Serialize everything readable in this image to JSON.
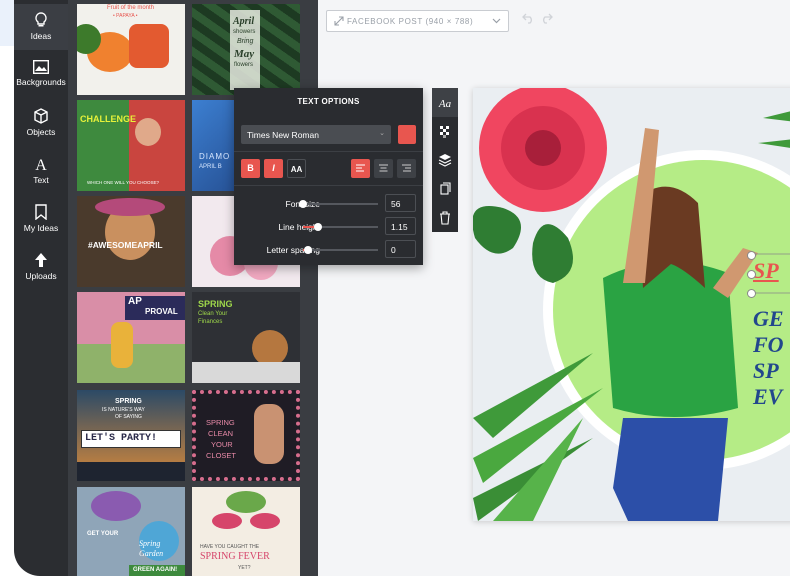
{
  "sidebar": {
    "items": [
      {
        "label": "Ideas",
        "icon": "lightbulb-icon"
      },
      {
        "label": "Backgrounds",
        "icon": "image-icon"
      },
      {
        "label": "Objects",
        "icon": "cube-icon"
      },
      {
        "label": "Text",
        "icon": "text-icon"
      },
      {
        "label": "My Ideas",
        "icon": "bookmark-icon"
      },
      {
        "label": "Uploads",
        "icon": "upload-arrow-icon"
      }
    ]
  },
  "templates": [
    {
      "lines": [
        "Fruit of the month",
        "• PAPAYA •"
      ]
    },
    {
      "lines": [
        "April",
        "showers",
        "Bring",
        "May",
        "flowers"
      ]
    },
    {
      "lines": [
        "CHALLENGE",
        "WHICH ONE WILL YOU CHOOSE?"
      ]
    },
    {
      "lines": [
        "DIAMO",
        "APRIL B"
      ]
    },
    {
      "lines": [
        "#AWESOMEAPRIL"
      ]
    },
    {
      "lines": []
    },
    {
      "lines": [
        "AP",
        "PROVAL"
      ]
    },
    {
      "lines": [
        "SPRING",
        "Clean Your",
        "Finances"
      ]
    },
    {
      "lines": [
        "SPRING",
        "IS NATURE'S WAY",
        "OF SAYING",
        "LET'S PARTY!"
      ]
    },
    {
      "lines": [
        "SPRING",
        "CLEAN",
        "YOUR",
        "CLOSET"
      ]
    },
    {
      "lines": [
        "GET YOUR",
        "Spring",
        "Garden",
        "GREEN AGAIN!"
      ]
    },
    {
      "lines": [
        "HAVE YOU CAUGHT THE",
        "SPRING FEVER",
        "YET?"
      ]
    }
  ],
  "topbar": {
    "size_label": "FACEBOOK POST (940 × 788)"
  },
  "text_options": {
    "title": "TEXT OPTIONS",
    "font": "Times New Roman",
    "color": "#e8564f",
    "style_buttons": [
      "B",
      "I",
      "AA"
    ],
    "font_size": {
      "label": "Font size",
      "value": "56",
      "level": 0.0
    },
    "line_height": {
      "label": "Line height",
      "value": "1.15",
      "level": 0.2
    },
    "letter_spacing": {
      "label": "Letter spacing",
      "value": "0",
      "level": 0.06
    }
  },
  "side_tools": [
    "text-style-icon",
    "transparency-icon",
    "layers-icon",
    "duplicate-icon",
    "trash-icon"
  ],
  "canvas": {
    "headline_top": "SP",
    "headline_lines": [
      "GE",
      "FO",
      "SP",
      "EV"
    ]
  },
  "colors": {
    "accent": "#e8564f",
    "panel_dark": "#2a2c30",
    "sidebar": "#2b2d31",
    "headline_blue": "#22478d",
    "circle_green": "#b5ec86"
  }
}
